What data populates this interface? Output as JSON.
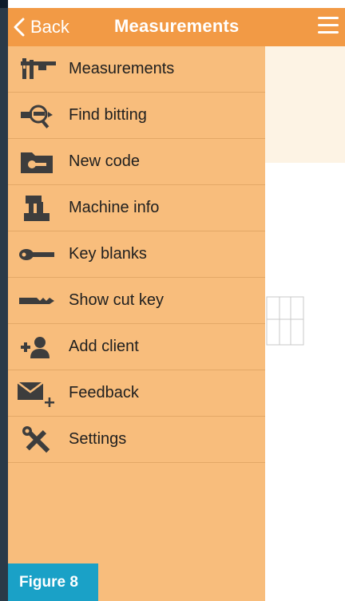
{
  "navbar": {
    "back_label": "Back",
    "title": "Measurements",
    "background": "#f29a45"
  },
  "drawer": {
    "background": "#f8bd7c",
    "items": [
      {
        "label": "Measurements",
        "icon": "caliper-icon"
      },
      {
        "label": "Find bitting",
        "icon": "key-magnifier-icon"
      },
      {
        "label": "New code",
        "icon": "folder-key-icon"
      },
      {
        "label": "Machine info",
        "icon": "machine-icon"
      },
      {
        "label": "Key blanks",
        "icon": "key-icon"
      },
      {
        "label": "Show cut key",
        "icon": "cut-key-icon"
      },
      {
        "label": "Add client",
        "icon": "add-user-icon"
      },
      {
        "label": "Feedback",
        "icon": "mail-plus-icon"
      },
      {
        "label": "Settings",
        "icon": "tools-icon"
      }
    ]
  },
  "figure_label": "Figure 8",
  "colors": {
    "accent": "#f29a45",
    "badge": "#1aa1c7",
    "icon": "#3d3d3d"
  }
}
